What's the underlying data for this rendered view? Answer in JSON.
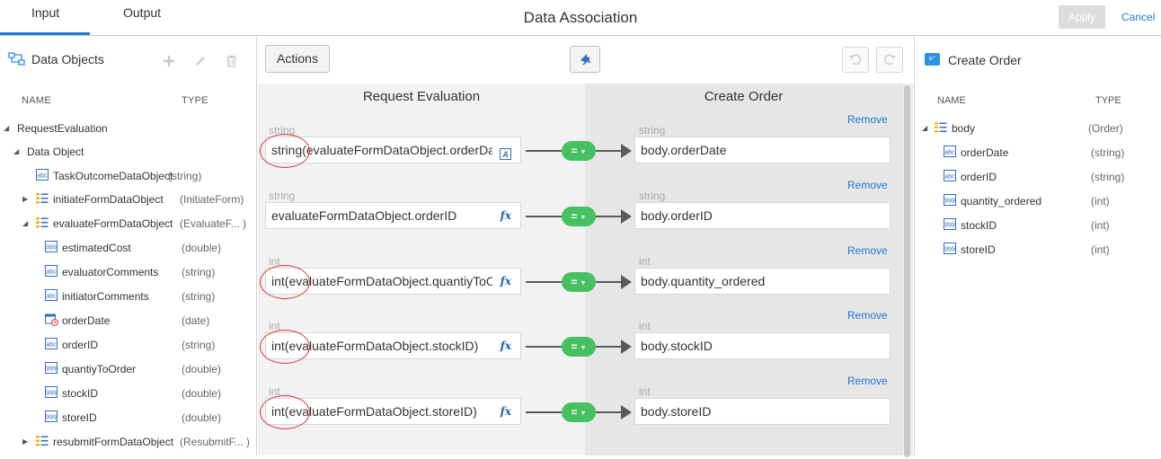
{
  "header": {
    "tabs": [
      {
        "label": "Input"
      },
      {
        "label": "Output"
      }
    ],
    "title": "Data Association",
    "apply_label": "Apply",
    "cancel_label": "Cancel"
  },
  "left_panel": {
    "title": "Data Objects",
    "col_name": "NAME",
    "col_type": "TYPE",
    "tree": [
      {
        "label": "RequestEvaluation",
        "type": ""
      },
      {
        "label": "Data Object",
        "type": ""
      },
      {
        "label": "TaskOutcomeDataObject",
        "type": "(string)"
      },
      {
        "label": "initiateFormDataObject",
        "type": "(InitiateForm)"
      },
      {
        "label": "evaluateFormDataObject",
        "type": "(EvaluateF... )"
      },
      {
        "label": "estimatedCost",
        "type": "(double)"
      },
      {
        "label": "evaluatorComments",
        "type": "(string)"
      },
      {
        "label": "initiatorComments",
        "type": "(string)"
      },
      {
        "label": "orderDate",
        "type": "(date)"
      },
      {
        "label": "orderID",
        "type": "(string)"
      },
      {
        "label": "quantiyToOrder",
        "type": "(double)"
      },
      {
        "label": "stockID",
        "type": "(double)"
      },
      {
        "label": "storeID",
        "type": "(double)"
      },
      {
        "label": "resubmitFormDataObject",
        "type": "(ResubmitF... )"
      }
    ]
  },
  "middle_panel": {
    "actions_label": "Actions",
    "source_heading": "Request Evaluation",
    "target_heading": "Create Order",
    "remove_label": "Remove",
    "mapping_op": "=",
    "mappings": [
      {
        "src_type": "string",
        "src_expr": "string(evaluateFormDataObject.orderDate)",
        "dst_type": "string",
        "dst_expr": "body.orderDate"
      },
      {
        "src_type": "string",
        "src_expr": "evaluateFormDataObject.orderID",
        "dst_type": "string",
        "dst_expr": "body.orderID"
      },
      {
        "src_type": "int",
        "src_expr": "int(evaluateFormDataObject.quantiyToOrder)",
        "dst_type": "int",
        "dst_expr": "body.quantity_ordered"
      },
      {
        "src_type": "int",
        "src_expr": "int(evaluateFormDataObject.stockID)",
        "dst_type": "int",
        "dst_expr": "body.stockID"
      },
      {
        "src_type": "int",
        "src_expr": "int(evaluateFormDataObject.storeID)",
        "dst_type": "int",
        "dst_expr": "body.storeID"
      }
    ],
    "fx_label": "fx"
  },
  "right_panel": {
    "title": "Create Order",
    "col_name": "NAME",
    "col_type": "TYPE",
    "tree": [
      {
        "label": "body",
        "type": "(Order)"
      },
      {
        "label": "orderDate",
        "type": "(string)"
      },
      {
        "label": "orderID",
        "type": "(string)"
      },
      {
        "label": "quantity_ordered",
        "type": "(int)"
      },
      {
        "label": "stockID",
        "type": "(int)"
      },
      {
        "label": "storeID",
        "type": "(int)"
      }
    ]
  },
  "colors": {
    "accent": "#1f78d1",
    "mapping_green": "#46c060",
    "annotation_red": "#dd3333"
  }
}
